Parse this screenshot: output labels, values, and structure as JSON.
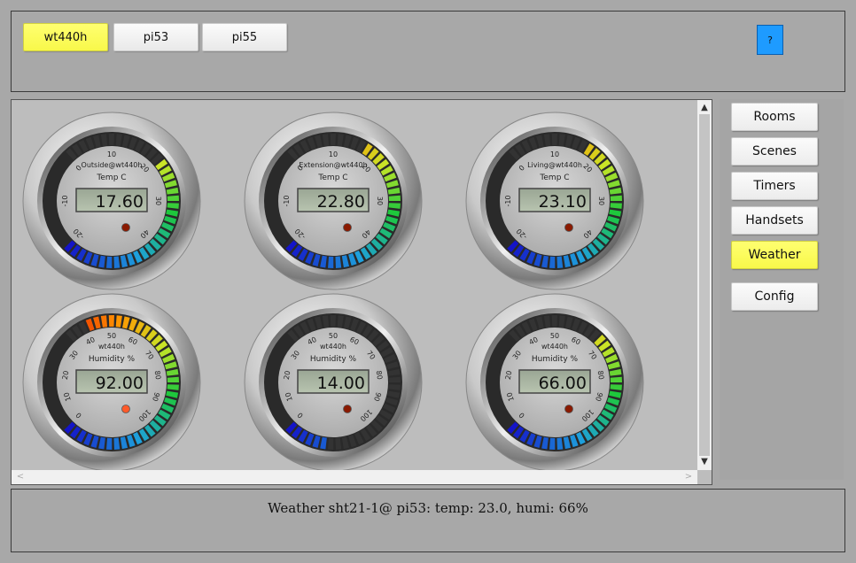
{
  "hosts": [
    {
      "label": "wt440h",
      "active": true
    },
    {
      "label": "pi53",
      "active": false
    },
    {
      "label": "pi55",
      "active": false
    }
  ],
  "help_label": "?",
  "nav": [
    {
      "label": "Rooms",
      "active": false
    },
    {
      "label": "Scenes",
      "active": false
    },
    {
      "label": "Timers",
      "active": false
    },
    {
      "label": "Handsets",
      "active": false
    },
    {
      "label": "Weather",
      "active": true
    },
    {
      "label": "Config",
      "active": false
    }
  ],
  "status_text": "Weather sht21-1@ pi53: temp: 23.0, humi: 66%",
  "scroll": {
    "up": "▲",
    "down": "▼",
    "left": "<",
    "right": ">"
  },
  "gauges": [
    {
      "kind": "temp",
      "top_label": "Outside@wt440h",
      "unit_label": "Temp C",
      "value": 17.6,
      "display": "17.60",
      "min": -20,
      "max": 40,
      "ticks": [
        "-20",
        "-10",
        "0",
        "10",
        "20",
        "30",
        "40"
      ],
      "led_on": false
    },
    {
      "kind": "temp",
      "top_label": "Extension@wt440h",
      "unit_label": "Temp C",
      "value": 22.8,
      "display": "22.80",
      "min": -20,
      "max": 40,
      "ticks": [
        "-20",
        "-10",
        "0",
        "10",
        "20",
        "30",
        "40"
      ],
      "led_on": false
    },
    {
      "kind": "temp",
      "top_label": "Living@wt440h",
      "unit_label": "Temp C",
      "value": 23.1,
      "display": "23.10",
      "min": -20,
      "max": 40,
      "ticks": [
        "-20",
        "-10",
        "0",
        "10",
        "20",
        "30",
        "40"
      ],
      "led_on": false
    },
    {
      "kind": "humi",
      "top_label": "wt440h",
      "unit_label": "Humidity %",
      "value": 92.0,
      "display": "92.00",
      "min": 0,
      "max": 100,
      "ticks": [
        "0",
        "10",
        "20",
        "30",
        "40",
        "50",
        "60",
        "70",
        "80",
        "90",
        "100"
      ],
      "led_on": true
    },
    {
      "kind": "humi",
      "top_label": "wt440h",
      "unit_label": "Humidity %",
      "value": 14.0,
      "display": "14.00",
      "min": 0,
      "max": 100,
      "ticks": [
        "0",
        "10",
        "20",
        "30",
        "40",
        "50",
        "60",
        "70",
        "80",
        "90",
        "100"
      ],
      "led_on": false
    },
    {
      "kind": "humi",
      "top_label": "wt440h",
      "unit_label": "Humidity %",
      "value": 66.0,
      "display": "66.00",
      "min": 0,
      "max": 100,
      "ticks": [
        "0",
        "10",
        "20",
        "30",
        "40",
        "50",
        "60",
        "70",
        "80",
        "90",
        "100"
      ],
      "led_on": false
    }
  ],
  "colors": {
    "active_button": "#f8f84a",
    "help_button": "#1e9bff",
    "lcd_background": "#b8c4b0",
    "led_off": "#8a1a00",
    "led_on": "#ff5a2a",
    "unlit_segment": "#333333"
  }
}
